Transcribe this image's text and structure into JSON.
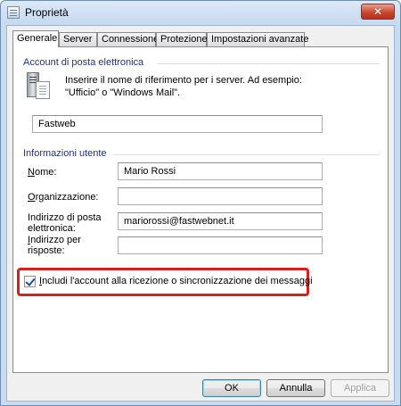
{
  "window": {
    "title": "Proprietà",
    "close_label": "✕"
  },
  "tabs": [
    {
      "label": "Generale"
    },
    {
      "label": "Server"
    },
    {
      "label": "Connessione"
    },
    {
      "label": "Protezione"
    },
    {
      "label": "Impostazioni avanzate"
    }
  ],
  "account_group": {
    "title": "Account di posta elettronica",
    "description": "Inserire il nome di riferimento per i server. Ad esempio: \"Ufficio\" o \"Windows Mail\".",
    "account_name": "Fastweb"
  },
  "user_group": {
    "title": "Informazioni utente",
    "name_label_u": "N",
    "name_label_rest": "ome:",
    "name_value": "Mario Rossi",
    "org_label_u": "O",
    "org_label_rest": "rganizzazione:",
    "org_value": "",
    "email_label": "Indirizzo di posta elettronica:",
    "email_value": "mariorossi@fastwebnet.it",
    "reply_label_u": "I",
    "reply_label_rest": "ndirizzo per risposte:",
    "reply_value": ""
  },
  "include_account": {
    "label_u": "I",
    "label_rest": "ncludi l'account alla ricezione o sincronizzazione dei messaggi",
    "checked": true
  },
  "buttons": {
    "ok": "OK",
    "cancel": "Annulla",
    "apply": "Applica"
  },
  "colors": {
    "highlight": "#d3221e",
    "group_title": "#1e3287"
  }
}
